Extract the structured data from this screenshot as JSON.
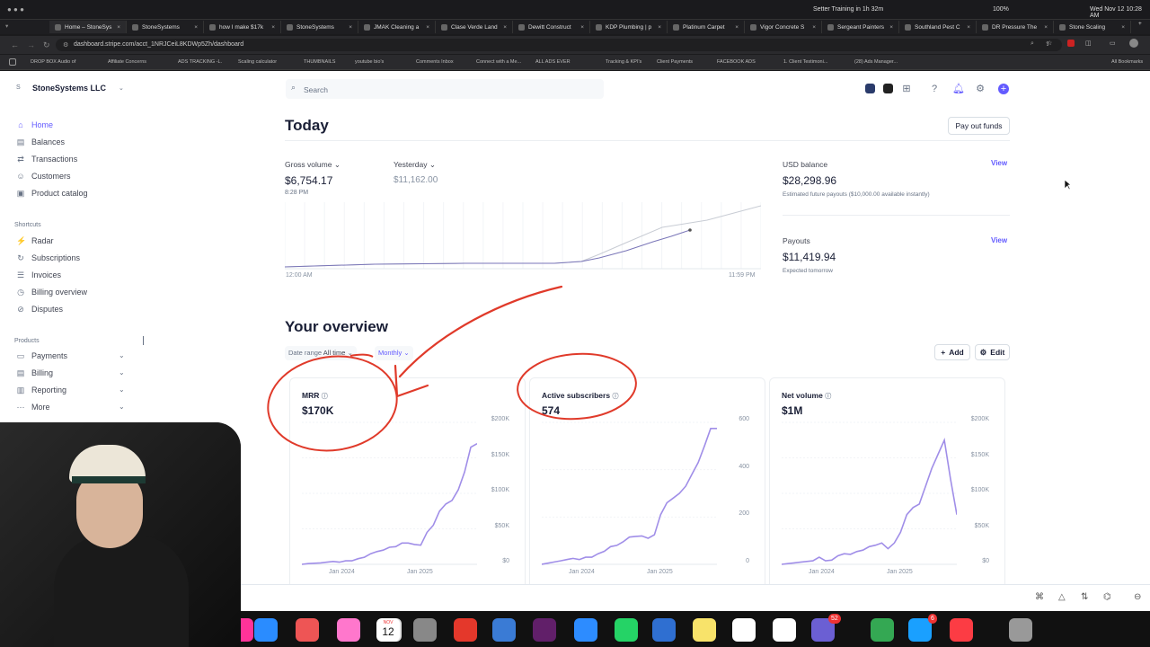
{
  "menubar": {
    "notification": "Setter Training in 1h 32m",
    "battery": "100%",
    "datetime": "Wed Nov 12  10:28 AM"
  },
  "tabs": [
    {
      "label": "Home – StoneSys",
      "active": true
    },
    {
      "label": "StoneSystems"
    },
    {
      "label": "how I make $17k"
    },
    {
      "label": "StoneSystems"
    },
    {
      "label": "JMAK Cleaning a"
    },
    {
      "label": "Clase Verde Land"
    },
    {
      "label": "Dewitt Construct"
    },
    {
      "label": "KDP Plumbing | p"
    },
    {
      "label": "Platinum Carpet"
    },
    {
      "label": "Vigor Concrete S"
    },
    {
      "label": "Sergeant Painters"
    },
    {
      "label": "Southland Pest C"
    },
    {
      "label": "DR Pressure The"
    },
    {
      "label": "Stone Scaling"
    }
  ],
  "address": {
    "url": "dashboard.stripe.com/acct_1NRJCeiL8KDWp5Zh/dashboard"
  },
  "bookmarks": [
    "DROP BOX Audio of",
    "Affiliate Concerns",
    "ADS TRACKING -L.",
    "Scaling calculator",
    "THUMBNAILS",
    "youtube bio's",
    "Comments Inbox",
    "Connect with a Me...",
    "ALL ADS EVER",
    "Tracking & KPI's",
    "Client Payments",
    "FACEBOOK ADS",
    "1. Client Testimoni...",
    "(28) Ads Manager...",
    "All Bookmarks"
  ],
  "sidebar": {
    "account_initial": "S",
    "account_name": "StoneSystems LLC",
    "main": [
      {
        "label": "Home",
        "icon": "home-icon",
        "active": true
      },
      {
        "label": "Balances",
        "icon": "balances-icon"
      },
      {
        "label": "Transactions",
        "icon": "transactions-icon"
      },
      {
        "label": "Customers",
        "icon": "customers-icon"
      },
      {
        "label": "Product catalog",
        "icon": "product-catalog-icon"
      }
    ],
    "shortcuts_title": "Shortcuts",
    "shortcuts": [
      {
        "label": "Radar",
        "icon": "radar-icon"
      },
      {
        "label": "Subscriptions",
        "icon": "subscriptions-icon"
      },
      {
        "label": "Invoices",
        "icon": "invoices-icon"
      },
      {
        "label": "Billing overview",
        "icon": "billing-overview-icon"
      },
      {
        "label": "Disputes",
        "icon": "disputes-icon"
      }
    ],
    "products_title": "Products",
    "products": [
      {
        "label": "Payments",
        "icon": "payments-icon"
      },
      {
        "label": "Billing",
        "icon": "billing-icon"
      },
      {
        "label": "Reporting",
        "icon": "reporting-icon"
      },
      {
        "label": "More",
        "icon": "more-icon"
      }
    ]
  },
  "search": {
    "placeholder": "Search"
  },
  "today": {
    "title": "Today",
    "payout_button": "Pay out funds",
    "gross_volume_label": "Gross volume",
    "gross_volume_value": "$6,754.17",
    "gross_volume_time": "8:28 PM",
    "yesterday_label": "Yesterday",
    "yesterday_value": "$11,162.00",
    "chart_start": "12:00 AM",
    "chart_end": "11:59 PM",
    "usd_balance_label": "USD balance",
    "usd_balance_value": "$28,298.96",
    "usd_balance_sub": "Estimated future payouts ($10,000.00 available instantly)",
    "payouts_label": "Payouts",
    "payouts_value": "$11,419.94",
    "payouts_sub": "Expected tomorrow",
    "view_link": "View"
  },
  "overview": {
    "title": "Your overview",
    "date_range_label": "Date range",
    "date_range_value": "All time",
    "interval": "Monthly",
    "add_button": "Add",
    "edit_button": "Edit"
  },
  "chart_data": [
    {
      "type": "line",
      "title": "MRR",
      "headline": "$170K",
      "ylim": [
        0,
        200000
      ],
      "yticks": [
        "$0",
        "$50K",
        "$100K",
        "$150K",
        "$200K"
      ],
      "xticks": [
        "Jan 2024",
        "Jan 2025"
      ],
      "x": [
        "2023-07",
        "2023-08",
        "2023-09",
        "2023-10",
        "2023-11",
        "2023-12",
        "2024-01",
        "2024-02",
        "2024-03",
        "2024-04",
        "2024-05",
        "2024-06",
        "2024-07",
        "2024-08",
        "2024-09",
        "2024-10",
        "2024-11",
        "2024-12",
        "2025-01",
        "2025-02",
        "2025-03",
        "2025-04",
        "2025-05",
        "2025-06",
        "2025-07",
        "2025-08",
        "2025-09",
        "2025-10",
        "2025-11"
      ],
      "values": [
        0,
        1000,
        1500,
        2000,
        3000,
        4000,
        3000,
        5000,
        5000,
        8000,
        10000,
        15000,
        18000,
        20000,
        24000,
        25000,
        30000,
        30000,
        28000,
        27000,
        45000,
        55000,
        75000,
        85000,
        90000,
        105000,
        130000,
        165000,
        170000
      ]
    },
    {
      "type": "line",
      "title": "Active subscribers",
      "headline": "574",
      "ylim": [
        0,
        600
      ],
      "yticks": [
        "0",
        "200",
        "400",
        "600"
      ],
      "xticks": [
        "Jan 2024",
        "Jan 2025"
      ],
      "x": [
        "2023-07",
        "2023-08",
        "2023-09",
        "2023-10",
        "2023-11",
        "2023-12",
        "2024-01",
        "2024-02",
        "2024-03",
        "2024-04",
        "2024-05",
        "2024-06",
        "2024-07",
        "2024-08",
        "2024-09",
        "2024-10",
        "2024-11",
        "2024-12",
        "2025-01",
        "2025-02",
        "2025-03",
        "2025-04",
        "2025-05",
        "2025-06",
        "2025-07",
        "2025-08",
        "2025-09",
        "2025-10",
        "2025-11"
      ],
      "values": [
        0,
        5,
        10,
        15,
        20,
        25,
        20,
        30,
        30,
        45,
        55,
        75,
        80,
        95,
        115,
        118,
        120,
        110,
        125,
        210,
        260,
        280,
        300,
        330,
        380,
        430,
        500,
        574,
        574
      ]
    },
    {
      "type": "line",
      "title": "Net volume",
      "headline": "$1M",
      "ylim": [
        0,
        200000
      ],
      "yticks": [
        "$0",
        "$50K",
        "$100K",
        "$150K",
        "$200K"
      ],
      "xticks": [
        "Jan 2024",
        "Jan 2025"
      ],
      "x": [
        "2023-07",
        "2023-08",
        "2023-09",
        "2023-10",
        "2023-11",
        "2023-12",
        "2024-01",
        "2024-02",
        "2024-03",
        "2024-04",
        "2024-05",
        "2024-06",
        "2024-07",
        "2024-08",
        "2024-09",
        "2024-10",
        "2024-11",
        "2024-12",
        "2025-01",
        "2025-02",
        "2025-03",
        "2025-04",
        "2025-05",
        "2025-06",
        "2025-07",
        "2025-08",
        "2025-09",
        "2025-10",
        "2025-11"
      ],
      "values": [
        0,
        1000,
        2000,
        3000,
        4000,
        5000,
        10000,
        5000,
        6000,
        12000,
        15000,
        14000,
        18000,
        20000,
        25000,
        27000,
        30000,
        22000,
        30000,
        45000,
        70000,
        80000,
        85000,
        110000,
        135000,
        155000,
        175000,
        120000,
        70000
      ]
    }
  ],
  "dock": {
    "calendar_month": "NOV",
    "calendar_day": "12",
    "badge_a": "52",
    "badge_b": "6"
  },
  "colors": {
    "accent": "#635bff",
    "line": "#a08ee8",
    "annotation": "#e03a2a"
  }
}
